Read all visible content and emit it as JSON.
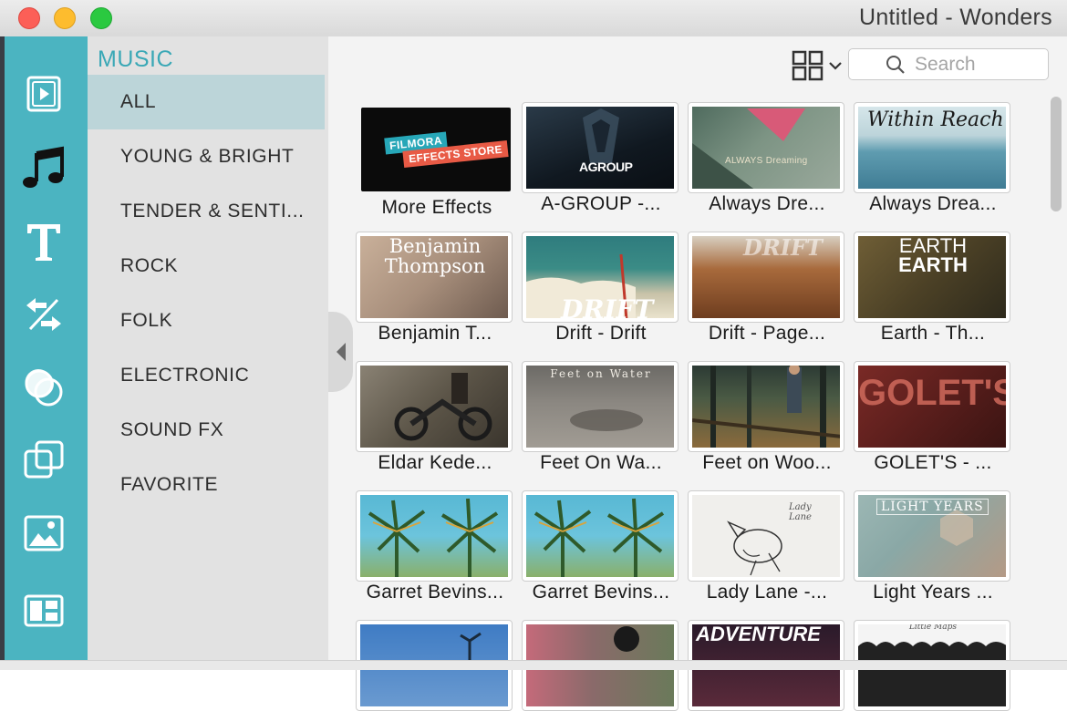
{
  "window": {
    "title": "Untitled - Wonders"
  },
  "sidebar_tools": [
    {
      "icon": "media-icon",
      "label": ""
    },
    {
      "icon": "music-note-icon",
      "label": ""
    },
    {
      "icon": "text-icon",
      "label": ""
    },
    {
      "icon": "transition-icon",
      "label": ""
    },
    {
      "icon": "filters-icon",
      "label": ""
    },
    {
      "icon": "overlays-icon",
      "label": ""
    },
    {
      "icon": "elements-icon",
      "label": ""
    },
    {
      "icon": "split-screen-icon",
      "label": ""
    }
  ],
  "library": {
    "section_title": "MUSIC",
    "categories": [
      {
        "label": "ALL",
        "selected": true
      },
      {
        "label": "YOUNG & BRIGHT",
        "selected": false
      },
      {
        "label": "TENDER & SENTI...",
        "selected": false
      },
      {
        "label": "ROCK",
        "selected": false
      },
      {
        "label": "FOLK",
        "selected": false
      },
      {
        "label": "ELECTRONIC",
        "selected": false
      },
      {
        "label": "SOUND FX",
        "selected": false
      },
      {
        "label": "FAVORITE",
        "selected": false
      }
    ]
  },
  "toolbar": {
    "view_icon": "grid-view-icon",
    "search_placeholder": "Search"
  },
  "tracks": [
    {
      "title": "More Effects",
      "badge_line1": "FILMORA",
      "badge_line2": "EFFECTS STORE"
    },
    {
      "title": "A-GROUP -...",
      "thumb_text": "AGROUP"
    },
    {
      "title": "Always Dre...",
      "thumb_text": "ALWAYS Dreaming"
    },
    {
      "title": "Always Drea...",
      "thumb_text": "Within Reach"
    },
    {
      "title": "Benjamin T...",
      "thumb_text": "Benjamin Thompson"
    },
    {
      "title": "Drift - Drift",
      "thumb_text": "DRIFT"
    },
    {
      "title": "Drift - Page...",
      "thumb_text": "DRIFT"
    },
    {
      "title": "Earth - Th...",
      "thumb_text": "EARTH",
      "thumb_text2": "EARTH"
    },
    {
      "title": "Eldar Kede...",
      "thumb_text": ""
    },
    {
      "title": "Feet On Wa...",
      "thumb_text": "Feet on Water"
    },
    {
      "title": "Feet on Woo...",
      "thumb_text": ""
    },
    {
      "title": "GOLET'S - ...",
      "thumb_text": "GOLET'S"
    },
    {
      "title": "Garret Bevins...",
      "thumb_text": ""
    },
    {
      "title": "Garret Bevins...",
      "thumb_text": ""
    },
    {
      "title": "Lady Lane -...",
      "thumb_text": "Lady Lane"
    },
    {
      "title": "Light Years ...",
      "thumb_text": "LIGHT YEARS"
    },
    {
      "title": "",
      "thumb_text": ""
    },
    {
      "title": "",
      "thumb_text": ""
    },
    {
      "title": "",
      "thumb_text": "ADVENTURE"
    },
    {
      "title": "",
      "thumb_text": "Little Maps"
    }
  ]
}
